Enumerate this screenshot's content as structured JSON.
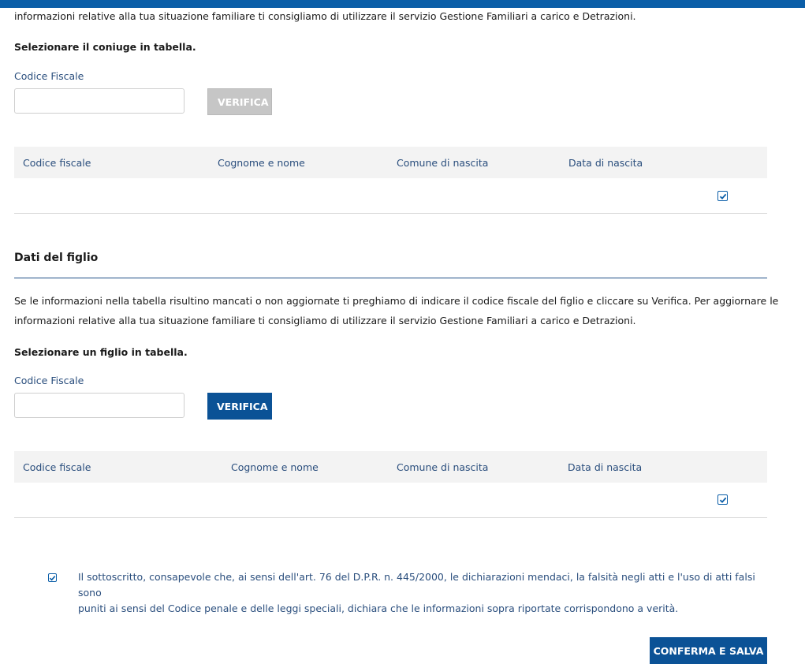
{
  "spouse": {
    "intro_tail": "informazioni relative alla tua situazione familiare ti consigliamo di utilizzare il servizio Gestione Familiari a carico e Detrazioni.",
    "select_prompt": "Selezionare il coniuge in tabella.",
    "field_label": "Codice Fiscale",
    "field_value": "",
    "field_placeholder": "",
    "verify_label": "VERIFICA",
    "table_headers": [
      "Codice fiscale",
      "Cognome e nome",
      "Comune di nascita",
      "Data di nascita"
    ],
    "row_checked": true
  },
  "child": {
    "section_title": "Dati del figlio",
    "intro_line1": "Se le informazioni nella tabella risultino mancati o non aggiornate ti preghiamo di indicare il codice fiscale del figlio e cliccare su Verifica. Per aggiornare le",
    "intro_line2": "informazioni relative alla tua situazione familiare ti consigliamo di utilizzare il servizio Gestione Familiari a carico e Detrazioni.",
    "select_prompt": "Selezionare un figlio in tabella.",
    "field_label": "Codice Fiscale",
    "field_value": "",
    "field_placeholder": "",
    "verify_label": "VERIFICA",
    "table_headers": [
      "Codice fiscale",
      "Cognome e nome",
      "Comune di nascita",
      "Data di nascita"
    ],
    "row_checked": true
  },
  "declaration": {
    "line1": "Il sottoscritto, consapevole che, ai sensi dell'art. 76 del D.P.R. n. 445/2000, le dichiarazioni mendaci, la falsità negli atti e l'uso di atti falsi sono",
    "line2": "puniti ai sensi del Codice penale e delle leggi speciali, dichiara che le informazioni sopra riportate corrispondono a verità.",
    "checked": true
  },
  "actions": {
    "save_label": "CONFERMA E SALVA"
  },
  "colors": {
    "primary": "#0b5296",
    "accent_blue": "#2a4e7d",
    "disabled": "#c6c6c6"
  }
}
